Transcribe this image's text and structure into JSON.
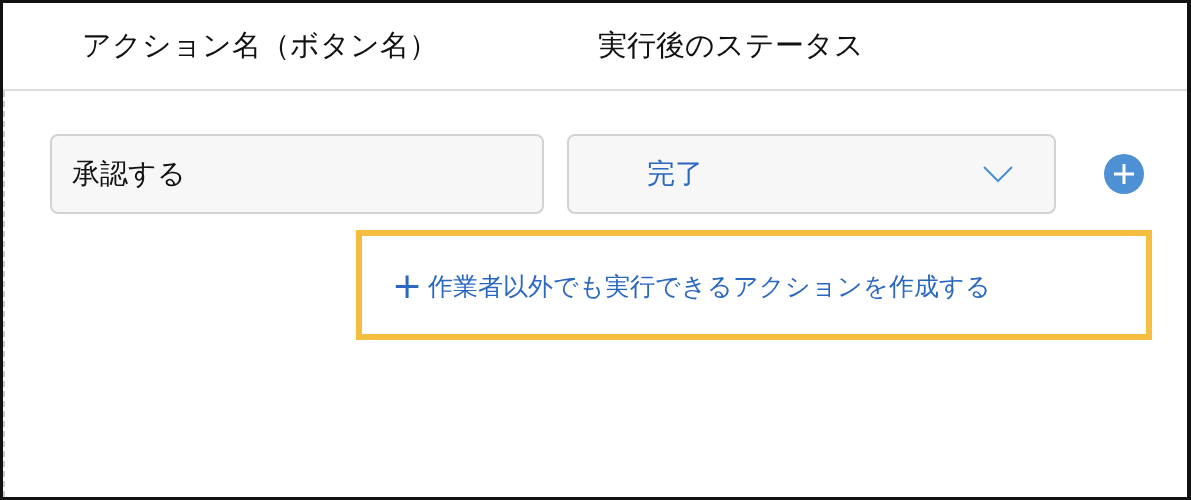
{
  "columns": [
    {
      "label": "アクション名（ボタン名）"
    },
    {
      "label": "実行後のステータス"
    }
  ],
  "actions": [
    {
      "name": "承認する",
      "status": "完了"
    }
  ],
  "add_action_link": {
    "icon": "+",
    "label": "作業者以外でも実行できるアクションを作成する",
    "highlighted": true
  }
}
